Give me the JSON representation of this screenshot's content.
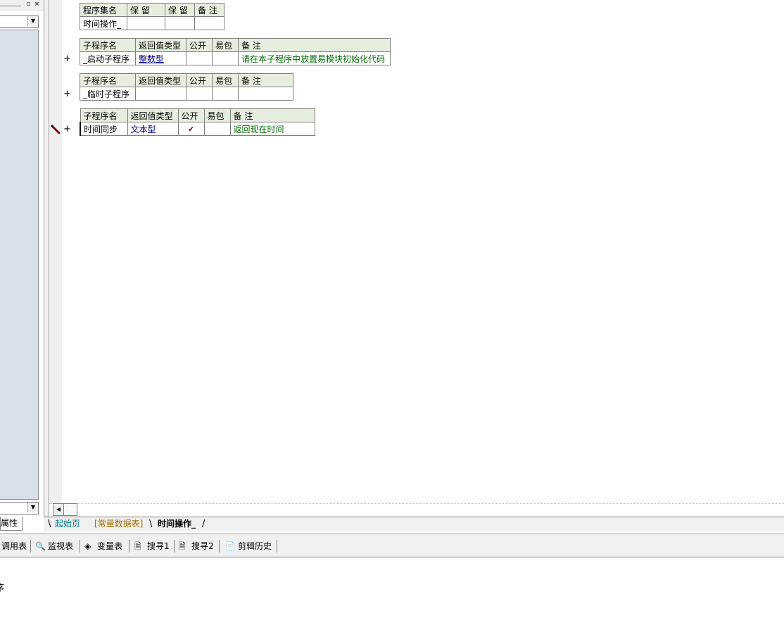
{
  "left_panel": {
    "restore_icon": "▫",
    "close_icon": "×",
    "dropdown_icon": "▼",
    "properties_tab": "属性"
  },
  "module_table": {
    "headers": [
      "程序集名",
      "保 留",
      "保 留",
      "备 注"
    ],
    "row": [
      "时间操作_",
      "",
      "",
      ""
    ]
  },
  "subroutines": [
    {
      "headers": [
        "子程序名",
        "返回值类型",
        "公开",
        "易包",
        "备 注"
      ],
      "row": [
        "_启动子程序",
        "整数型",
        "",
        "",
        "请在本子程序中放置易模块初始化代码"
      ],
      "expand": "+"
    },
    {
      "headers": [
        "子程序名",
        "返回值类型",
        "公开",
        "易包",
        "备 注"
      ],
      "row": [
        "_临时子程序",
        "",
        "",
        "",
        ""
      ],
      "expand": "+"
    },
    {
      "headers": [
        "子程序名",
        "返回值类型",
        "公开",
        "易包",
        "备 注"
      ],
      "row": [
        "时间同步",
        "文本型",
        "✔",
        "",
        "返回现在时间"
      ],
      "expand": "+"
    }
  ],
  "doc_tabs": [
    "起始页",
    "[常量数据表]",
    "时间操作_"
  ],
  "toolbar": {
    "call_table": "调用表",
    "watch": "监视表",
    "vars": "变量表",
    "search1": "搜寻1",
    "search2": "搜寻2",
    "clip_history": "剪辑历史"
  },
  "output": {
    "line": "序"
  },
  "scroll_left_icon": "◀"
}
